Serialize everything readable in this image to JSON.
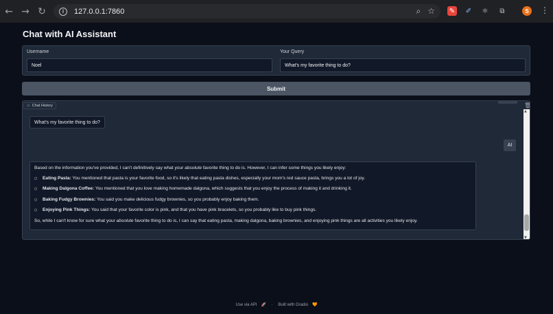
{
  "browser": {
    "url": "127.0.0.1:7860",
    "avatar_letter": "S"
  },
  "page": {
    "title": "Chat with AI Assistant"
  },
  "form": {
    "username_label": "Username",
    "username_value": "Noel",
    "query_label": "Your Query",
    "query_value": "What's my favorite thing to do?",
    "submit_label": "Submit"
  },
  "chat": {
    "label": "Chat History",
    "user_message": "What's my favorite thing to do?",
    "ai_tag": "AI",
    "ai_intro_pre": "Based on the information you've provided, I can't definitively say what your ",
    "ai_intro_em": "absolute",
    "ai_intro_post": " favorite thing to do is. However, I can infer some things you likely enjoy:",
    "items": [
      {
        "title": "Eating Pasta:",
        "text": " You mentioned that pasta is your favorite food, so it's likely that eating pasta dishes, especially your mom's red sauce pasta, brings you a lot of joy."
      },
      {
        "title": "Making Dalgona Coffee:",
        "text": " You mentioned that you love making homemade dalgona, which suggests that you enjoy the process of making it and drinking it."
      },
      {
        "title": "Baking Fudgy Brownies:",
        "text": " You said you make delicious fudgy brownies, so you probably enjoy baking them."
      },
      {
        "title": "Enjoying Pink Things:",
        "text": " You said that your favorite color is pink, and that you have pink bracelets, so you probably like to buy pink things."
      }
    ],
    "ai_outro_pre": "So, while I can't know for sure what your ",
    "ai_outro_em": "absolute",
    "ai_outro_post": " favorite thing to do is, I can say that eating pasta, making dalgona, baking brownies, and enjoying pink things are all activities you likely enjoy."
  },
  "footer": {
    "api_label": "Use via API",
    "separator": "·",
    "built_label": "Built with Gradio"
  }
}
